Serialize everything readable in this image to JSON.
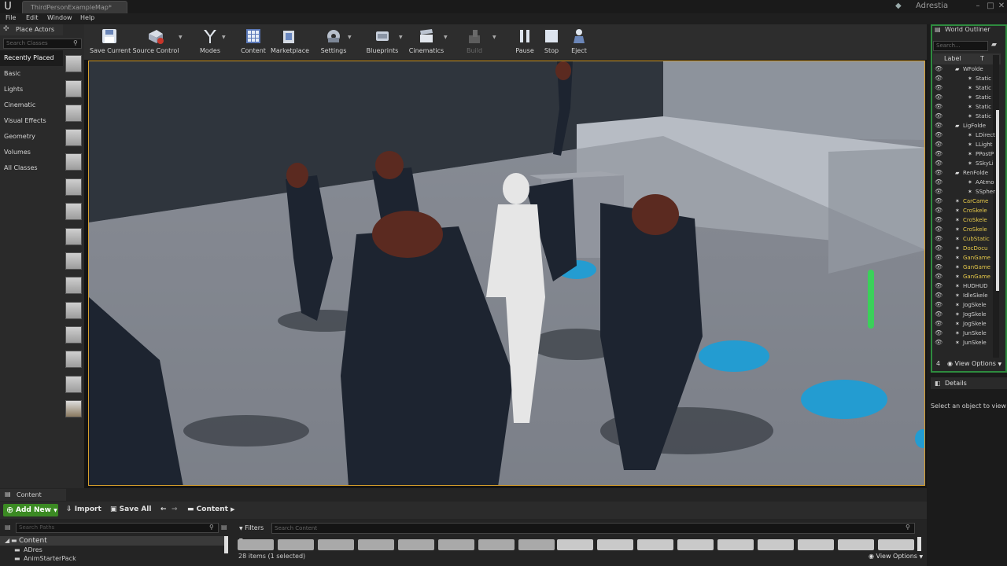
{
  "titlebar": {
    "doc_tab": "ThirdPersonExampleMap*",
    "user": "Adrestia"
  },
  "menu": [
    "File",
    "Edit",
    "Window",
    "Help"
  ],
  "place_actors": {
    "tab": "Place Actors",
    "search_placeholder": "Search Classes",
    "categories": [
      "Recently Placed",
      "Basic",
      "Lights",
      "Cinematic",
      "Visual Effects",
      "Geometry",
      "Volumes",
      "All Classes"
    ]
  },
  "toolbar": {
    "buttons": [
      "Save Current",
      "Source Control",
      "Modes",
      "Content",
      "Marketplace",
      "Settings",
      "Blueprints",
      "Cinematics",
      "Build",
      "Pause",
      "Stop",
      "Eject"
    ]
  },
  "content_browser": {
    "tab": "Content Browser",
    "add_new": "Add New",
    "import": "Import",
    "save_all": "Save All",
    "path": "Content",
    "search_paths_placeholder": "Search Paths",
    "filters": "Filters",
    "search_content_placeholder": "Search Content",
    "tree": [
      "Content",
      "ADres",
      "AnimStarterPack"
    ],
    "status": "28 items (1 selected)",
    "view_options": "View Options"
  },
  "world_outliner": {
    "tab": "World Outliner",
    "search_placeholder": "Search...",
    "column_label": "Label",
    "column_type": "T",
    "rows": [
      "WFolde",
      "Static",
      "Static",
      "Static",
      "Static",
      "Static",
      "LigFolde",
      "LDirect",
      "LLight",
      "PPostP",
      "SSkyLi",
      "RenFolde",
      "AAtmo",
      "SSpher",
      "CarCame",
      "CroSkele",
      "CroSkele",
      "CroSkele",
      "CubStatic",
      "DocDocu",
      "GanGame",
      "GanGame",
      "GanGame",
      "HUDHUD",
      "IdleSkele",
      "JogSkele",
      "JogSkele",
      "JogSkele",
      "JunSkele",
      "JunSkele"
    ],
    "count": "4",
    "view_options": "View Options"
  },
  "details": {
    "tab": "Details",
    "empty_message": "Select an object to view de"
  },
  "colors": {
    "viewport_border": "#d79f2c",
    "add_new": "#3b8a23",
    "outliner_border": "#2e8b3e",
    "floor_text": "#1aa0d8"
  }
}
